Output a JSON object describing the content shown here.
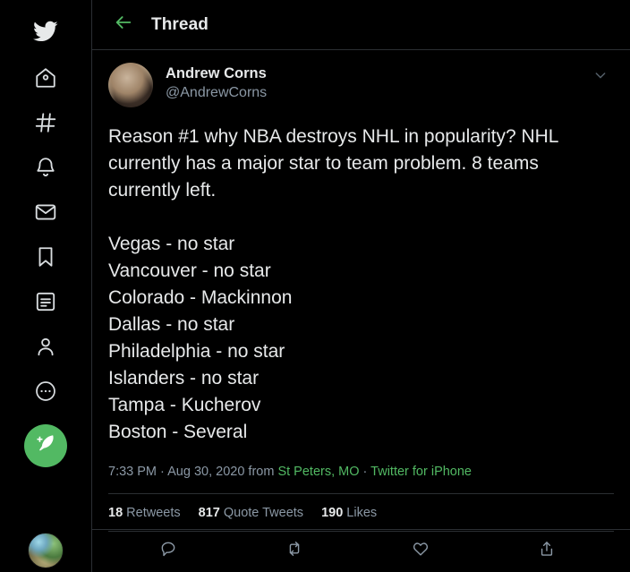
{
  "colors": {
    "background": "#000000",
    "accent_green": "#52b963",
    "text_primary": "#e7e9ea",
    "text_secondary": "#8b98a5",
    "divider": "#2b2f33"
  },
  "sidebar": {
    "items": [
      {
        "icon": "twitter-bird-icon",
        "label": "Twitter"
      },
      {
        "icon": "home-icon",
        "label": "Home"
      },
      {
        "icon": "hashtag-icon",
        "label": "Explore"
      },
      {
        "icon": "bell-icon",
        "label": "Notifications"
      },
      {
        "icon": "envelope-icon",
        "label": "Messages"
      },
      {
        "icon": "bookmark-icon",
        "label": "Bookmarks"
      },
      {
        "icon": "list-icon",
        "label": "Lists"
      },
      {
        "icon": "person-icon",
        "label": "Profile"
      },
      {
        "icon": "more-circle-icon",
        "label": "More"
      }
    ],
    "compose": {
      "icon": "compose-feather-icon",
      "label": "Tweet"
    },
    "account_avatar": {
      "icon": "avatar",
      "label": "Account"
    }
  },
  "header": {
    "back_icon": "arrow-left-icon",
    "title": "Thread"
  },
  "tweet": {
    "author": {
      "display_name": "Andrew Corns",
      "handle": "@AndrewCorns",
      "avatar": "avatar"
    },
    "menu_icon": "chevron-down-icon",
    "body": "Reason #1 why NBA destroys NHL in popularity? NHL currently has a major star to team problem. 8 teams currently left.\n\nVegas - no star\nVancouver - no star\nColorado - Mackinnon\nDallas - no star\nPhiladelphia - no star\nIslanders - no star\nTampa - Kucherov\nBoston - Several",
    "meta": {
      "time": "7:33 PM",
      "separator": "·",
      "date": "Aug 30, 2020",
      "from_word": "from",
      "location": "St Peters, MO",
      "client": "Twitter for iPhone"
    },
    "stats": [
      {
        "count": "18",
        "label": "Retweets"
      },
      {
        "count": "817",
        "label": "Quote Tweets"
      },
      {
        "count": "190",
        "label": "Likes"
      }
    ],
    "actions": [
      {
        "icon": "reply-icon",
        "label": "Reply"
      },
      {
        "icon": "retweet-icon",
        "label": "Retweet"
      },
      {
        "icon": "like-heart-icon",
        "label": "Like"
      },
      {
        "icon": "share-icon",
        "label": "Share"
      }
    ]
  }
}
